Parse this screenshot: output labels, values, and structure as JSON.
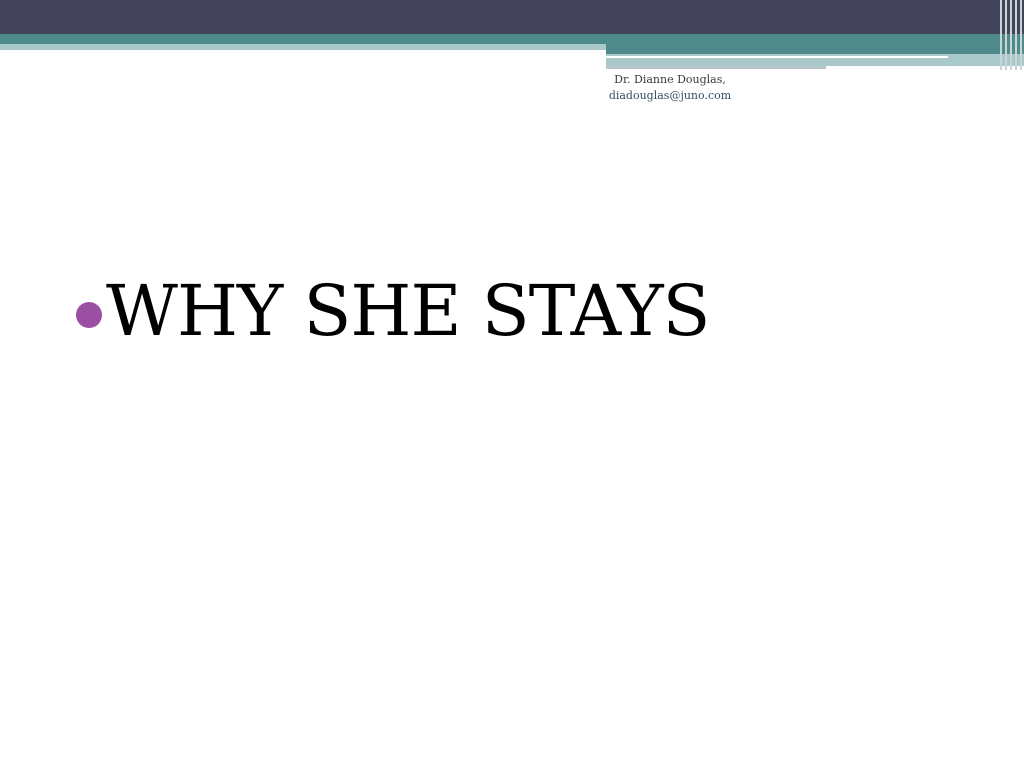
{
  "slide": {
    "author_name": "Dr. Dianne Douglas,",
    "author_email": "diadouglas@juno.com",
    "bullet_text": "WHY SHE STAYS"
  },
  "colors": {
    "header_dark": "#434459",
    "header_teal": "#4f8a8b",
    "header_light": "#a9c8c9",
    "bullet": "#9b4fa3"
  }
}
